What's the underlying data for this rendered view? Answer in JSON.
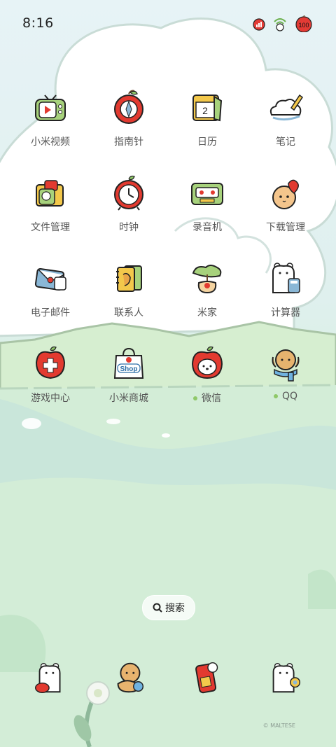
{
  "status_bar": {
    "time": "8:16",
    "battery": "100"
  },
  "apps": [
    {
      "label": "小米视频",
      "icon": "tv-icon"
    },
    {
      "label": "指南针",
      "icon": "compass-apple-icon"
    },
    {
      "label": "日历",
      "icon": "calendar-icon",
      "day": "2"
    },
    {
      "label": "笔记",
      "icon": "cloud-pencil-icon"
    },
    {
      "label": "文件管理",
      "icon": "folder-icon"
    },
    {
      "label": "时钟",
      "icon": "apple-clock-icon"
    },
    {
      "label": "录音机",
      "icon": "cassette-icon"
    },
    {
      "label": "下载管理",
      "icon": "dog-heart-icon"
    },
    {
      "label": "电子邮件",
      "icon": "envelope-icon"
    },
    {
      "label": "联系人",
      "icon": "contacts-book-icon"
    },
    {
      "label": "米家",
      "icon": "plant-icon"
    },
    {
      "label": "计算器",
      "icon": "bear-calculator-icon"
    },
    {
      "label": "游戏中心",
      "icon": "game-apple-icon"
    },
    {
      "label": "小米商城",
      "icon": "shop-bag-icon",
      "badge": "Shop"
    },
    {
      "label": "微信",
      "icon": "dog-apple-icon",
      "new": true
    },
    {
      "label": "QQ",
      "icon": "dog-scarf-icon",
      "new": true
    }
  ],
  "search": {
    "label": "搜索"
  },
  "dock": [
    {
      "name": "phone",
      "icon": "bear-phone-icon"
    },
    {
      "name": "messages",
      "icon": "dog-ball-icon"
    },
    {
      "name": "browser",
      "icon": "apple-phone-icon"
    },
    {
      "name": "camera",
      "icon": "bear-camera-icon"
    }
  ],
  "watermark": "© MALTESE",
  "colors": {
    "accent_red": "#e23a30",
    "accent_green": "#8fc868",
    "text": "#555555"
  }
}
